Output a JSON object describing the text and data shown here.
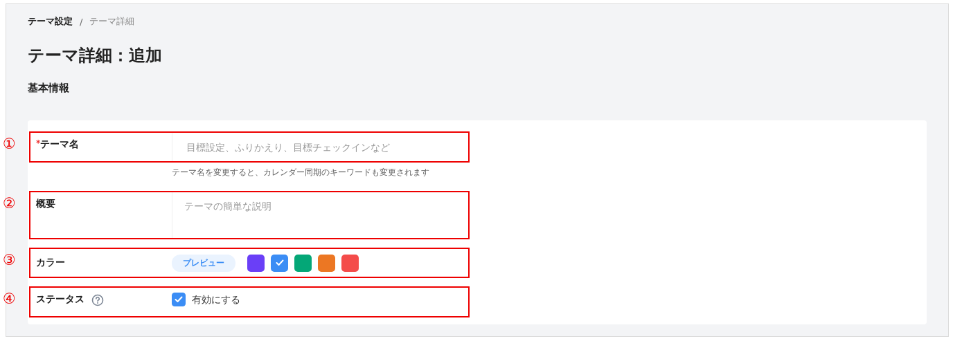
{
  "breadcrumb": [
    {
      "label": "テーマ設定",
      "current": false
    },
    {
      "label": "テーマ詳細",
      "current": true
    }
  ],
  "breadcrumb_separator": "/",
  "title": "テーマ詳細：追加",
  "section": "基本情報",
  "form": {
    "name": {
      "marker": "①",
      "required_mark": "*",
      "label": "テーマ名",
      "placeholder": "目標設定、ふりかえり、目標チェックインなど",
      "hint": "テーマ名を変更すると、カレンダー同期のキーワードも変更されます"
    },
    "summary": {
      "marker": "②",
      "label": "概要",
      "placeholder": "テーマの簡単な説明"
    },
    "color": {
      "marker": "③",
      "label": "カラー",
      "preview": "プレビュー",
      "swatches": [
        {
          "color": "#6a3ff7",
          "selected": false
        },
        {
          "color": "#3b8df5",
          "selected": true
        },
        {
          "color": "#04a777",
          "selected": false
        },
        {
          "color": "#ec7723",
          "selected": false
        },
        {
          "color": "#f44c4a",
          "selected": false
        }
      ]
    },
    "status": {
      "marker": "④",
      "label": "ステータス",
      "checkbox_label": "有効にする",
      "checked": true
    }
  }
}
